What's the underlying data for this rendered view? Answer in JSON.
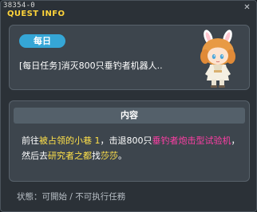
{
  "window": {
    "id_text": "38354-0",
    "title": "QUEST INFO",
    "close_glyph": "✕"
  },
  "quest": {
    "badge": "每日",
    "title": "[每日任务]消灭800只垂钓者机器人.."
  },
  "content": {
    "header": "内容",
    "segments": [
      {
        "text": "前往",
        "style": "normal"
      },
      {
        "text": "被占领的小巷 1",
        "style": "yellow"
      },
      {
        "text": "，击退800只",
        "style": "normal"
      },
      {
        "text": "垂钓者炮击型试验机",
        "style": "pink"
      },
      {
        "text": "，然后去",
        "style": "normal"
      },
      {
        "text": "研究者之都",
        "style": "yellow"
      },
      {
        "text": "找",
        "style": "normal"
      },
      {
        "text": "莎莎",
        "style": "yellow"
      },
      {
        "text": "。",
        "style": "normal"
      }
    ]
  },
  "status": {
    "text": "状態：可開始 / 不可执行任務"
  },
  "colors": {
    "title": "#ffd43a",
    "badge": "#35a6d6",
    "highlight_yellow": "#ffe14a",
    "highlight_pink": "#ff3ea5"
  },
  "icons": {
    "npc": "npc-portrait-icon"
  }
}
